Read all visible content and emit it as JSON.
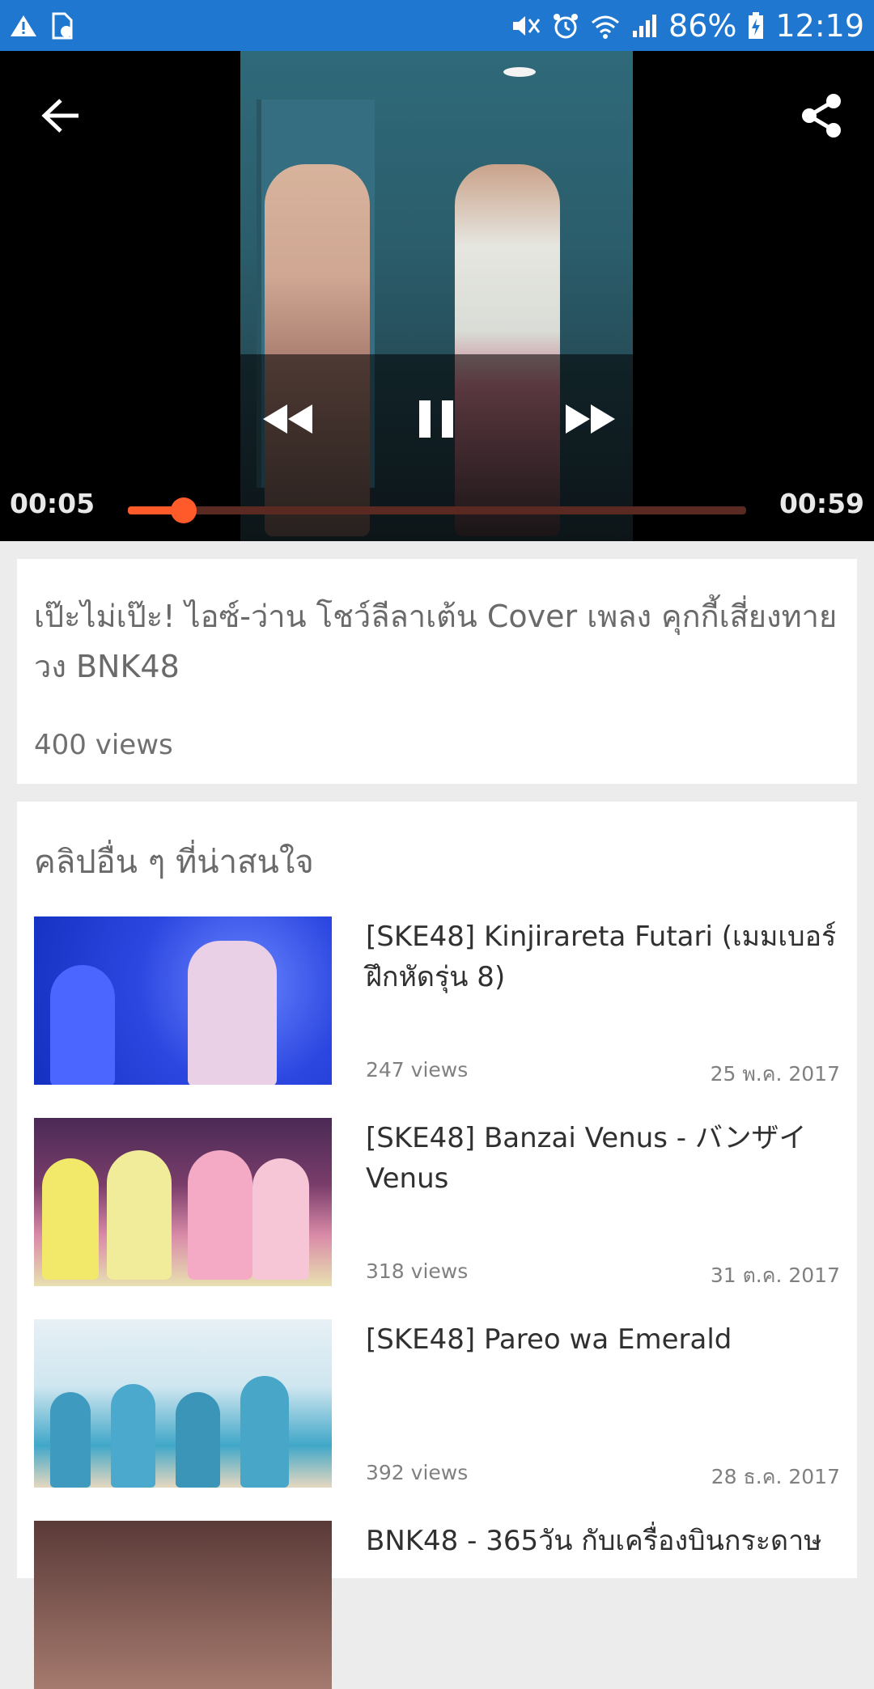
{
  "status_bar": {
    "battery": "86%",
    "time": "12:19",
    "icons": [
      "warning-icon",
      "sim-card-icon",
      "mute-icon",
      "alarm-icon",
      "wifi-icon",
      "signal-icon",
      "battery-icon"
    ]
  },
  "player": {
    "current_time": "00:05",
    "total_time": "00:59",
    "progress": 0.09,
    "state": "playing",
    "accent_color": "#ff5a2a"
  },
  "video": {
    "title": "เป๊ะไม่เป๊ะ! ไอซ์-ว่าน โชว์ลีลาเต้น Cover เพลง คุกกี้เสี่ยงทาย วง BNK48",
    "views": "400 views"
  },
  "related": {
    "heading": "คลิปอื่น ๆ ที่น่าสนใจ",
    "items": [
      {
        "title": "[SKE48] Kinjirareta Futari (เมมเบอร์ฝึกหัดรุ่น 8)",
        "views": "247 views",
        "date": "25 พ.ค. 2017"
      },
      {
        "title": "[SKE48] Banzai Venus - バンザイVenus",
        "views": "318 views",
        "date": "31 ต.ค. 2017"
      },
      {
        "title": "[SKE48] Pareo wa Emerald",
        "views": "392 views",
        "date": "28 ธ.ค. 2017"
      },
      {
        "title": "BNK48 - 365วัน กับเครื่องบินกระดาษ",
        "views": "",
        "date": ""
      }
    ]
  }
}
